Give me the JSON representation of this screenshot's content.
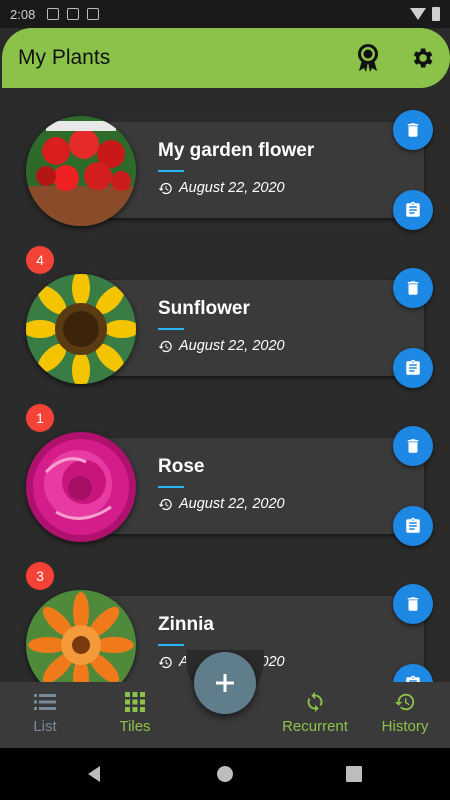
{
  "status_bar": {
    "time": "2:08"
  },
  "app_bar": {
    "title": "My Plants",
    "actions": [
      "award-icon",
      "gear-icon"
    ]
  },
  "plants": [
    {
      "name": "My garden flower",
      "date": "August 22, 2020",
      "badge": ""
    },
    {
      "name": "Sunflower",
      "date": "August 22, 2020",
      "badge": "4"
    },
    {
      "name": "Rose",
      "date": "August 22, 2020",
      "badge": "1"
    },
    {
      "name": "Zinnia",
      "date": "August 22, 2020",
      "badge": "3"
    }
  ],
  "bottom_nav": {
    "list": "List",
    "tiles": "Tiles",
    "recurrent": "Recurrent",
    "history": "History"
  },
  "colors": {
    "appbar": "#8bc34a",
    "accent_blue": "#1e88e5",
    "badge_red": "#f44336",
    "fab": "#607d8b",
    "active_nav": "#8bc34a",
    "inactive_nav": "#7a8a9a"
  }
}
